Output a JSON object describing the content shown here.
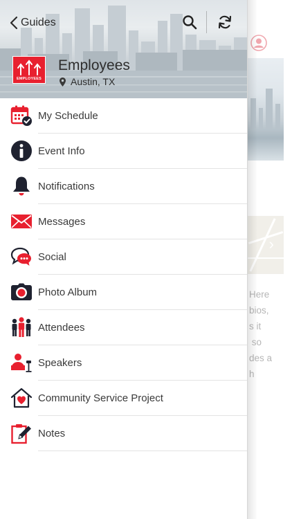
{
  "header": {
    "back_label": "Guides",
    "org_name": "Employees",
    "logo_text": "EMPLOYEES",
    "location": "Austin, TX"
  },
  "menu": {
    "items": [
      {
        "label": "My Schedule",
        "icon": "calendar-check-icon"
      },
      {
        "label": "Event Info",
        "icon": "info-icon"
      },
      {
        "label": "Notifications",
        "icon": "bell-icon"
      },
      {
        "label": "Messages",
        "icon": "envelope-icon"
      },
      {
        "label": "Social",
        "icon": "chat-bubbles-icon"
      },
      {
        "label": "Photo Album",
        "icon": "camera-icon"
      },
      {
        "label": "Attendees",
        "icon": "people-icon"
      },
      {
        "label": "Speakers",
        "icon": "speaker-icon"
      },
      {
        "label": "Community Service Project",
        "icon": "house-heart-icon"
      },
      {
        "label": "Notes",
        "icon": "note-pen-icon"
      }
    ]
  },
  "background_page": {
    "text": "Here\nbios,\ns it\n so\ndes a\nh"
  },
  "colors": {
    "accent_red": "#e8202f",
    "dark_icon": "#1f2230",
    "text": "#3a3a3a"
  }
}
